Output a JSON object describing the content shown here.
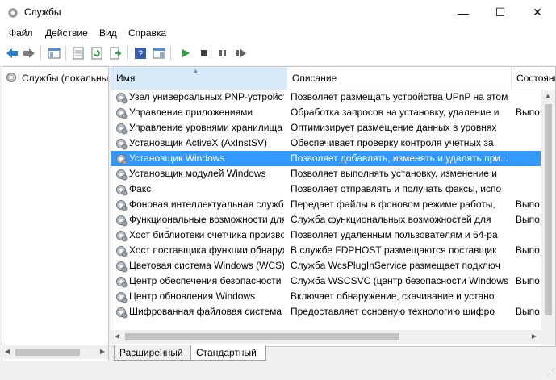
{
  "window": {
    "title": "Службы",
    "minimize": "—",
    "maximize": "☐",
    "close": "✕"
  },
  "menu": [
    "Файл",
    "Действие",
    "Вид",
    "Справка"
  ],
  "tree": {
    "label": "Службы (локальные)"
  },
  "columns": {
    "name": "Имя",
    "description": "Описание",
    "state": "Состояние"
  },
  "rows": [
    {
      "name": "Узел универсальных PNP-устройств",
      "description": "Позволяет размещать устройства UPnP на этом",
      "state": ""
    },
    {
      "name": "Управление приложениями",
      "description": "Обработка запросов на установку, удаление и",
      "state": "Выполняется"
    },
    {
      "name": "Управление уровнями хранилища",
      "description": "Оптимизирует размещение данных в уровнях",
      "state": ""
    },
    {
      "name": "Установщик ActiveX (AxInstSV)",
      "description": "Обеспечивает проверку контроля учетных за",
      "state": ""
    },
    {
      "name": "Установщик Windows",
      "description": "Позволяет добавлять, изменять и удалять при...",
      "state": "",
      "selected": true
    },
    {
      "name": "Установщик модулей Windows",
      "description": "Позволяет выполнять установку, изменение и",
      "state": ""
    },
    {
      "name": "Факс",
      "description": "Позволяет отправлять и получать факсы, испо",
      "state": ""
    },
    {
      "name": "Фоновая интеллектуальная служба",
      "description": "Передает файлы в фоновом режиме работы,",
      "state": "Выполняется"
    },
    {
      "name": "Функциональные возможности для",
      "description": "Служба функциональных возможностей для",
      "state": "Выполняется"
    },
    {
      "name": "Хост библиотеки счетчика производительности",
      "description": "Позволяет удаленным пользователям и 64-ра",
      "state": ""
    },
    {
      "name": "Хост поставщика функции обнаружения",
      "description": "В службе FDPHOST размещаются поставщик",
      "state": "Выполняется"
    },
    {
      "name": "Цветовая система Windows (WCS)",
      "description": "Служба WcsPlugInService размещает подключ",
      "state": ""
    },
    {
      "name": "Центр обеспечения безопасности",
      "description": "Служба WSCSVC (центр безопасности Windows",
      "state": "Выполняется"
    },
    {
      "name": "Центр обновления Windows",
      "description": "Включает обнаружение, скачивание и устано",
      "state": ""
    },
    {
      "name": "Шифрованная файловая система",
      "description": "Предоставляет основную технологию шифро",
      "state": "Выполняется"
    }
  ],
  "tabs": [
    "Расширенный",
    "Стандартный"
  ],
  "colors": {
    "selection": "#3399ff",
    "sorted_header": "#d9ebf9"
  }
}
